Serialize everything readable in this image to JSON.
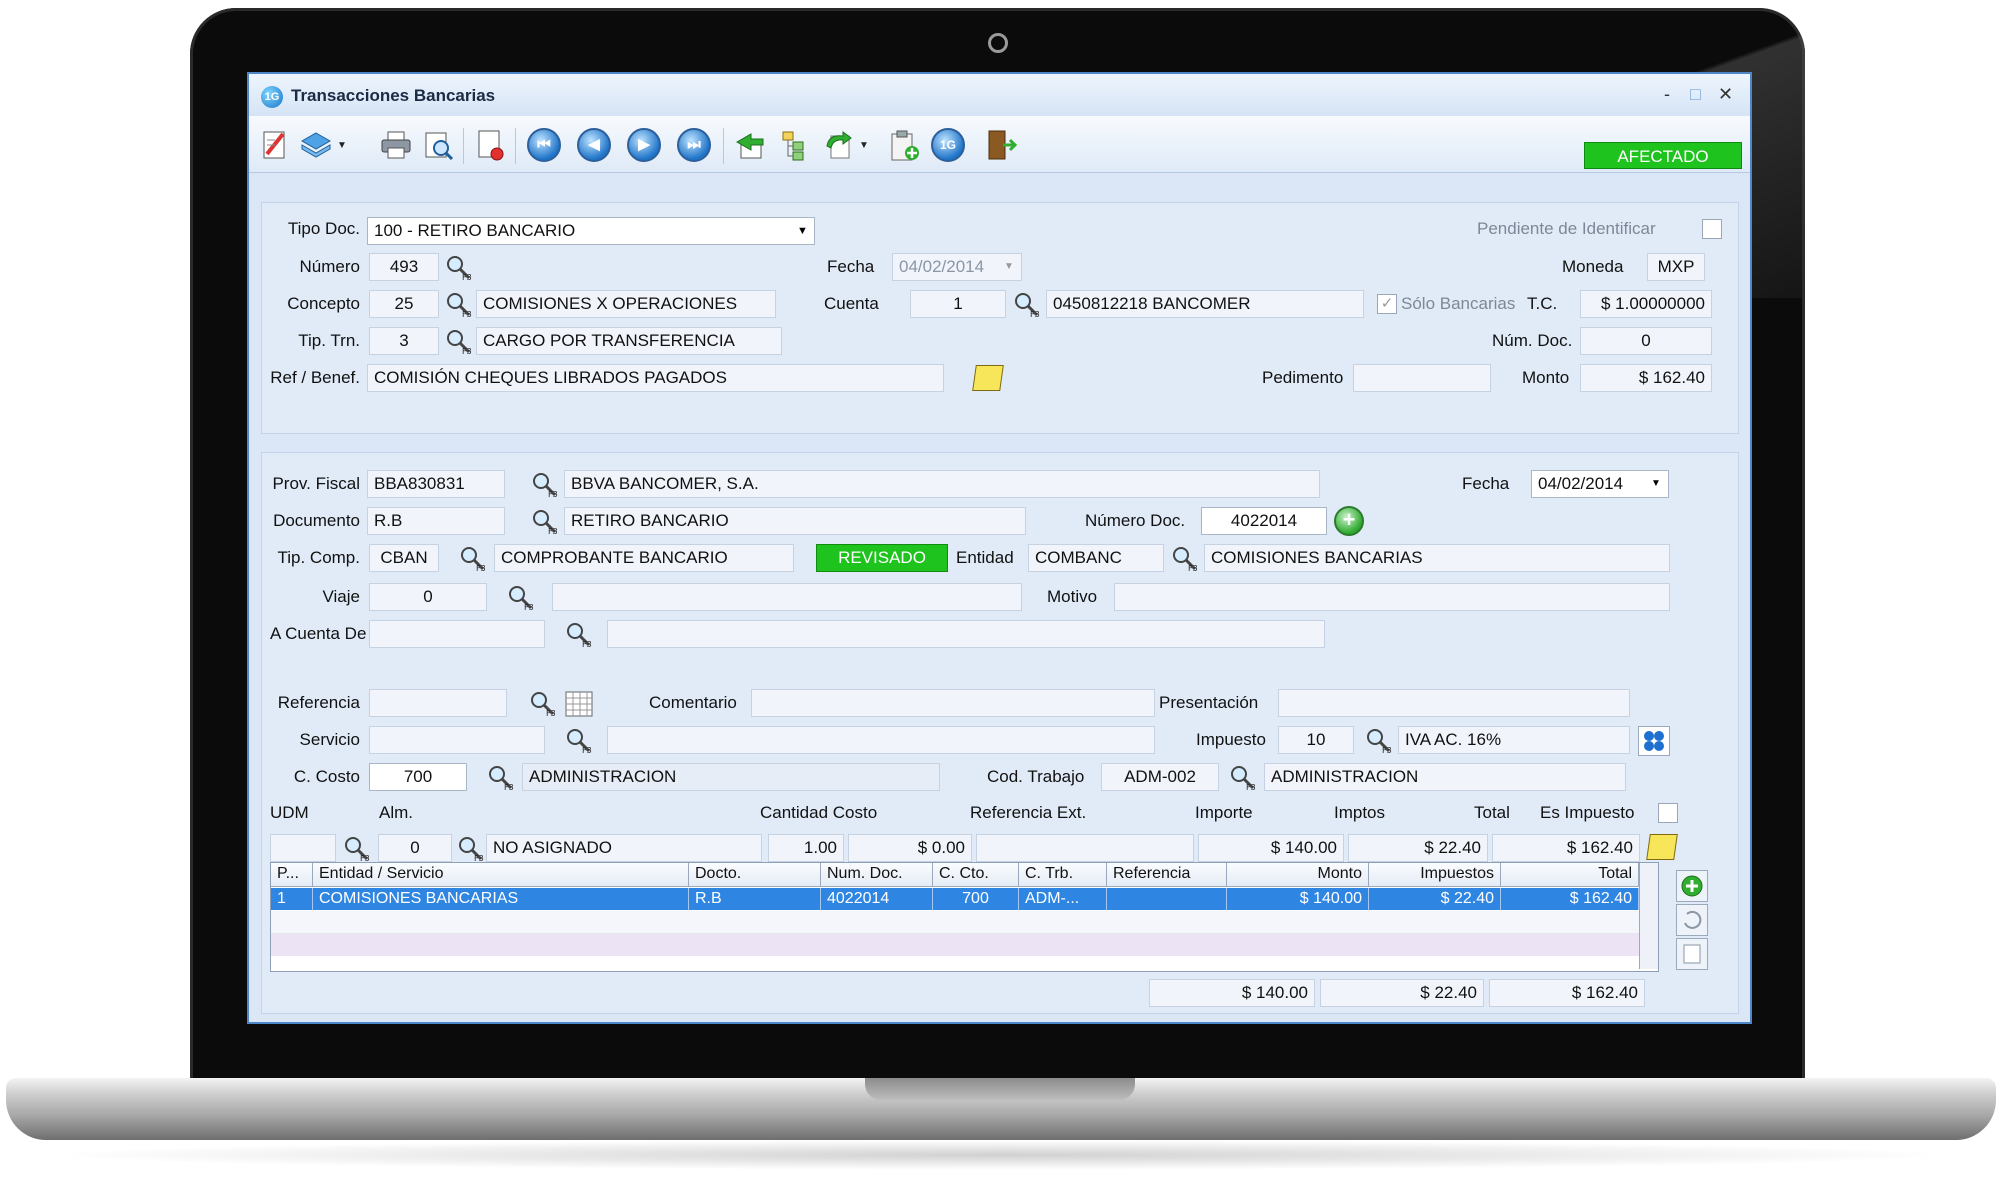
{
  "window": {
    "title": "Transacciones Bancarias",
    "app_icon": "1G",
    "status": "AFECTADO",
    "min": "-",
    "max": "□",
    "close": "✕"
  },
  "toolbar": {
    "icons": [
      "edit-icon",
      "layers-icon",
      "print-icon",
      "preview-icon",
      "delete-doc-icon",
      "first-icon",
      "prev-icon",
      "next-icon",
      "last-icon",
      "apply-icon",
      "tree-icon",
      "redo-icon",
      "clipboard-add-icon",
      "app-logo-icon",
      "exit-icon"
    ]
  },
  "header": {
    "tipo_doc": {
      "label": "Tipo Doc.",
      "value": "100 - RETIRO BANCARIO"
    },
    "pendiente": {
      "label": "Pendiente de Identificar"
    },
    "numero": {
      "label": "Número",
      "value": "493"
    },
    "fecha": {
      "label": "Fecha",
      "value": "04/02/2014"
    },
    "moneda": {
      "label": "Moneda",
      "value": "MXP"
    },
    "concepto": {
      "label": "Concepto",
      "value": "25",
      "desc": "COMISIONES X OPERACIONES"
    },
    "cuenta": {
      "label": "Cuenta",
      "value": "1",
      "desc": "0450812218 BANCOMER"
    },
    "solo_bancarias": {
      "label": "Sólo Bancarias"
    },
    "tc": {
      "label": "T.C.",
      "value": "$ 1.00000000"
    },
    "tip_trn": {
      "label": "Tip. Trn.",
      "value": "3",
      "desc": "CARGO POR TRANSFERENCIA"
    },
    "num_doc": {
      "label": "Núm. Doc.",
      "value": "0"
    },
    "ref_benef": {
      "label": "Ref / Benef.",
      "value": "COMISIÓN CHEQUES LIBRADOS PAGADOS"
    },
    "pedimento": {
      "label": "Pedimento",
      "value": ""
    },
    "monto": {
      "label": "Monto",
      "value": "$ 162.40"
    }
  },
  "detail": {
    "prov_fiscal": {
      "label": "Prov. Fiscal",
      "value": "BBA830831",
      "desc": "BBVA BANCOMER, S.A."
    },
    "fecha": {
      "label": "Fecha",
      "value": "04/02/2014"
    },
    "documento": {
      "label": "Documento",
      "value": "R.B",
      "desc": "RETIRO BANCARIO"
    },
    "numero_doc": {
      "label": "Número Doc.",
      "value": "4022014"
    },
    "tip_comp": {
      "label": "Tip. Comp.",
      "value": "CBAN",
      "desc": "COMPROBANTE BANCARIO",
      "badge": "REVISADO"
    },
    "entidad": {
      "label": "Entidad",
      "value": "COMBANC",
      "desc": "COMISIONES BANCARIAS"
    },
    "viaje": {
      "label": "Viaje",
      "value": "0"
    },
    "motivo": {
      "label": "Motivo",
      "value": ""
    },
    "a_cuenta_de": {
      "label": "A Cuenta De",
      "value": ""
    },
    "referencia": {
      "label": "Referencia",
      "value": ""
    },
    "comentario": {
      "label": "Comentario",
      "value": ""
    },
    "presentacion": {
      "label": "Presentación",
      "value": ""
    },
    "servicio": {
      "label": "Servicio",
      "value": ""
    },
    "impuesto": {
      "label": "Impuesto",
      "value": "10",
      "desc": "IVA AC. 16%"
    },
    "c_costo": {
      "label": "C. Costo",
      "value": "700",
      "desc": "ADMINISTRACION"
    },
    "cod_trabajo": {
      "label": "Cod. Trabajo",
      "value": "ADM-002",
      "desc": "ADMINISTRACION"
    },
    "line_labels": {
      "udm": "UDM",
      "alm": "Alm.",
      "cantidad_costo": "Cantidad Costo",
      "referencia_ext": "Referencia Ext.",
      "importe": "Importe",
      "imptos": "Imptos",
      "total": "Total",
      "es_impuesto": "Es Impuesto"
    },
    "line_values": {
      "udm": "",
      "alm": "0",
      "alm_desc": "NO ASIGNADO",
      "cantidad": "1.00",
      "costo": "$ 0.00",
      "referencia_ext": "",
      "importe": "$ 140.00",
      "imptos": "$ 22.40",
      "total": "$ 162.40"
    }
  },
  "grid": {
    "columns": [
      "P...",
      "Entidad / Servicio",
      "Docto.",
      "Num. Doc.",
      "C. Cto.",
      "C. Trb.",
      "Referencia",
      "Monto",
      "Impuestos",
      "Total"
    ],
    "rows": [
      {
        "p": "1",
        "entidad": "COMISIONES BANCARIAS",
        "docto": "R.B",
        "num_doc": "4022014",
        "c_cto": "700",
        "c_trb": "ADM-...",
        "referencia": "",
        "monto": "$ 140.00",
        "impuestos": "$ 22.40",
        "total": "$ 162.40"
      }
    ],
    "totals": {
      "monto": "$ 140.00",
      "impuestos": "$ 22.40",
      "total": "$ 162.40"
    }
  },
  "colors": {
    "accent": "#1ec31e",
    "selection": "#2f86e2",
    "panel": "#e1ebf8",
    "frame": "#4d87c9"
  }
}
